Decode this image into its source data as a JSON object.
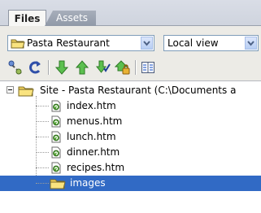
{
  "tabs": [
    {
      "label": "Files",
      "active": true
    },
    {
      "label": "Assets",
      "active": false
    }
  ],
  "site_select": {
    "value": "Pasta Restaurant",
    "icon": "folder-icon"
  },
  "view_select": {
    "value": "Local view"
  },
  "toolbar_icons": [
    "connect-icon",
    "refresh-icon",
    "get-files-icon",
    "put-files-icon",
    "check-out-icon",
    "check-in-icon",
    "expand-site-icon"
  ],
  "tree": {
    "root": {
      "label": "Site - Pasta Restaurant (C:\\Documents a",
      "icon": "folder-icon",
      "expanded": true
    },
    "items": [
      {
        "label": "index.htm",
        "icon": "html-file-icon"
      },
      {
        "label": "menus.htm",
        "icon": "html-file-icon"
      },
      {
        "label": "lunch.htm",
        "icon": "html-file-icon"
      },
      {
        "label": "dinner.htm",
        "icon": "html-file-icon"
      },
      {
        "label": "recipes.htm",
        "icon": "html-file-icon"
      },
      {
        "label": "images",
        "icon": "folder-icon",
        "selected": true
      }
    ]
  },
  "colors": {
    "selection": "#316ac5",
    "folder": "#f5d45c",
    "arrow_green": "#3fa33a"
  }
}
